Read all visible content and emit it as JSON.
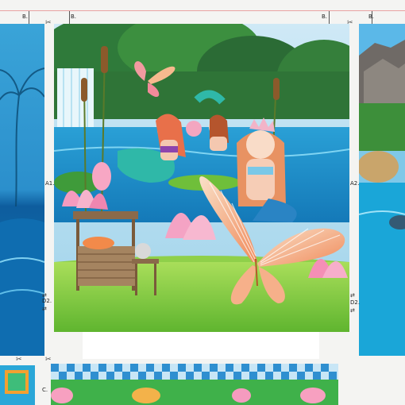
{
  "markers": {
    "b_left_1": "B.",
    "b_left_2": "B.",
    "b_right_1": "B.",
    "b_right_2": "B.",
    "a1": "A1.",
    "a2": "A2.",
    "d2_left": "D2.",
    "d2_right": "D2.",
    "c_bottom": "C."
  },
  "icons": {
    "scissors": "scissors-icon",
    "arrows": "double-arrow-icon"
  },
  "colors": {
    "sheet": "#f4f4f2",
    "cutline": "#e9a2a2",
    "sky": "#bfe4f5",
    "forest": "#2f7a3a",
    "water": "#1f8fd0",
    "grass": "#7ccf3c",
    "butterfly": "#f7a66e",
    "mermaid_hair": "#e8704a"
  }
}
